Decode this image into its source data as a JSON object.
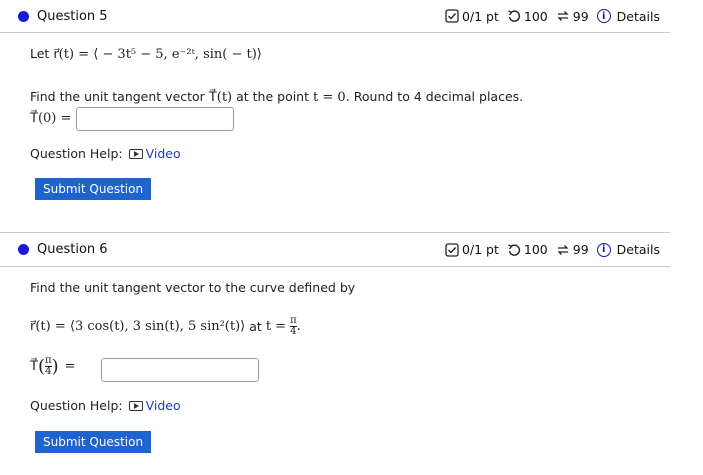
{
  "q5": {
    "title": "Question 5",
    "meta": {
      "score": "0/1 pt",
      "retries": "100",
      "attempts": "99",
      "details": "Details"
    },
    "let_text": "Let",
    "vector_r": "r⃗(t) = ⟨ − 3t⁵ − 5, e⁻²ᵗ, sin( − t)⟩",
    "prompt_prefix": "Find the unit tangent vector",
    "prompt_T": "T⃗(t)",
    "prompt_mid": "at the point",
    "prompt_point": "t = 0.",
    "prompt_suffix": "Round to 4 decimal places.",
    "answer_label": "T⃗(0) =",
    "answer_value": "",
    "help_label": "Question Help:",
    "video_label": "Video",
    "submit_label": "Submit Question"
  },
  "q6": {
    "title": "Question 6",
    "meta": {
      "score": "0/1 pt",
      "retries": "100",
      "attempts": "99",
      "details": "Details"
    },
    "prompt": "Find the unit tangent vector to the curve defined by",
    "vector_r": "r⃗(t) = ⟨3 cos(t), 3 sin(t), 5 sin²(t)⟩",
    "at_text": "at",
    "t_eq": "t =",
    "pi": "π",
    "four": "4",
    "answer_T": "T⃗",
    "answer_eq": "=",
    "answer_value": "",
    "help_label": "Question Help:",
    "video_label": "Video",
    "submit_label": "Submit Question"
  }
}
